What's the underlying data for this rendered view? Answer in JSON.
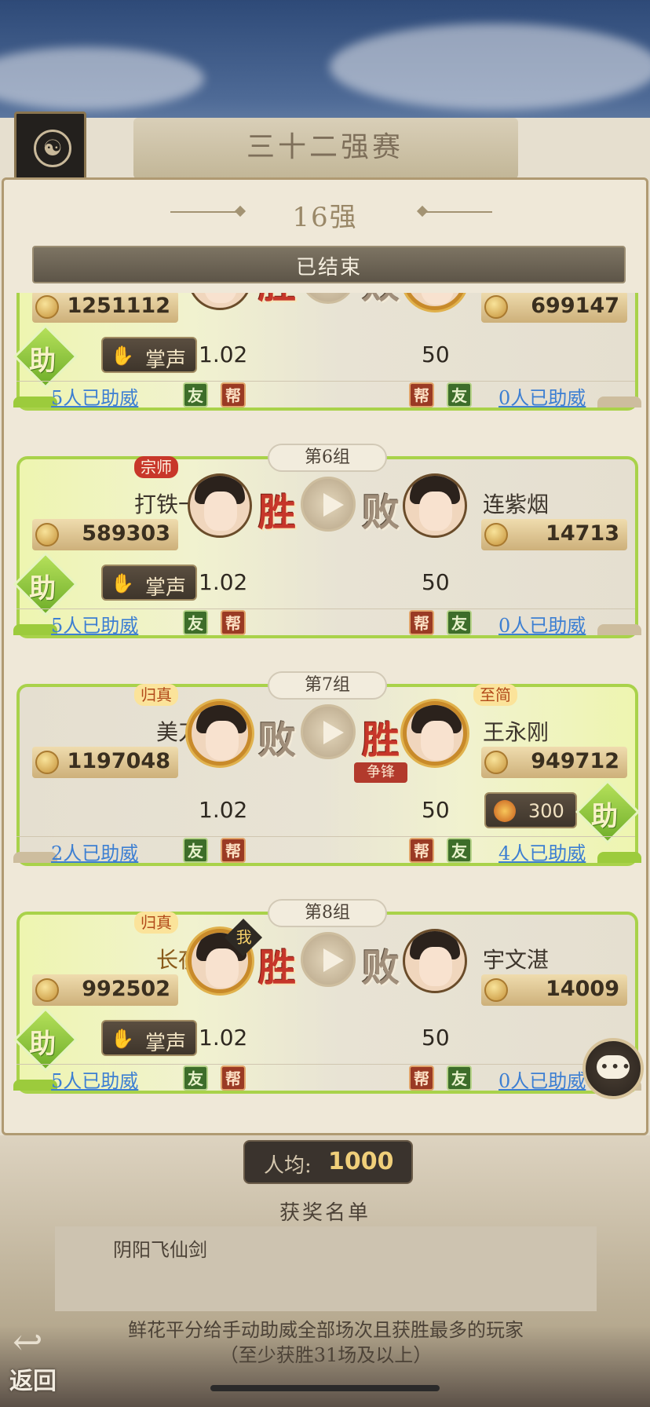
{
  "background": {
    "title": "三十二强赛",
    "avg_label": "人均:",
    "avg_value": "1000",
    "award_title": "获奖名单",
    "award_items": [
      "阴阳飞仙剑"
    ],
    "award_note": "鲜花平分给手动助威全部场次且获胜最多的玩家（至少获胜31场及以上）",
    "back_label": "返回"
  },
  "modal": {
    "title": "16强",
    "status": "已结束"
  },
  "labels": {
    "win": "胜",
    "lose": "败",
    "help": "助",
    "clap": "掌声",
    "friend_tag": "友",
    "guild_tag": "帮",
    "me_badge": "我",
    "zhengfeng": "争锋"
  },
  "matches": [
    {
      "group": "",
      "left": {
        "name": "",
        "score": "1251112",
        "odds": "1.02",
        "supporters": "5人已助威",
        "rank": "",
        "result": "胜"
      },
      "right": {
        "name": "",
        "score": "699147",
        "odds": "50",
        "supporters": "0人已助威",
        "rank": "",
        "result": "败"
      },
      "winner": "left"
    },
    {
      "group": "第6组",
      "left": {
        "name": "打铁一号",
        "score": "589303",
        "odds": "1.02",
        "supporters": "5人已助威",
        "rank": "宗师",
        "result": "胜"
      },
      "right": {
        "name": "连紫烟",
        "score": "14713",
        "odds": "50",
        "supporters": "0人已助威",
        "rank": "",
        "result": "败"
      },
      "winner": "left"
    },
    {
      "group": "第7组",
      "left": {
        "name": "美刀刀",
        "score": "1197048",
        "odds": "1.02",
        "supporters": "2人已助威",
        "rank": "归真",
        "result": "败"
      },
      "right": {
        "name": "王永刚",
        "score": "949712",
        "odds": "50",
        "supporters": "4人已助威",
        "rank": "至简",
        "result": "胜",
        "gift": "300"
      },
      "winner": "right"
    },
    {
      "group": "第8组",
      "left": {
        "name": "长夜行",
        "score": "992502",
        "odds": "1.02",
        "supporters": "5人已助威",
        "rank": "归真",
        "result": "胜"
      },
      "right": {
        "name": "宇文湛",
        "score": "14009",
        "odds": "50",
        "supporters": "0人已助威",
        "rank": "",
        "result": "败"
      },
      "winner": "left"
    }
  ],
  "colors": {
    "win_green": "#a9d24a",
    "win_red": "#c6362a",
    "link_blue": "#3d7fd2",
    "gold": "#f0cf7a"
  },
  "icons": [
    "dragon-emblem-icon",
    "coin-icon",
    "clap-icon",
    "play-icon",
    "chat-icon",
    "back-arrow-icon",
    "flower-gift-icon"
  ]
}
